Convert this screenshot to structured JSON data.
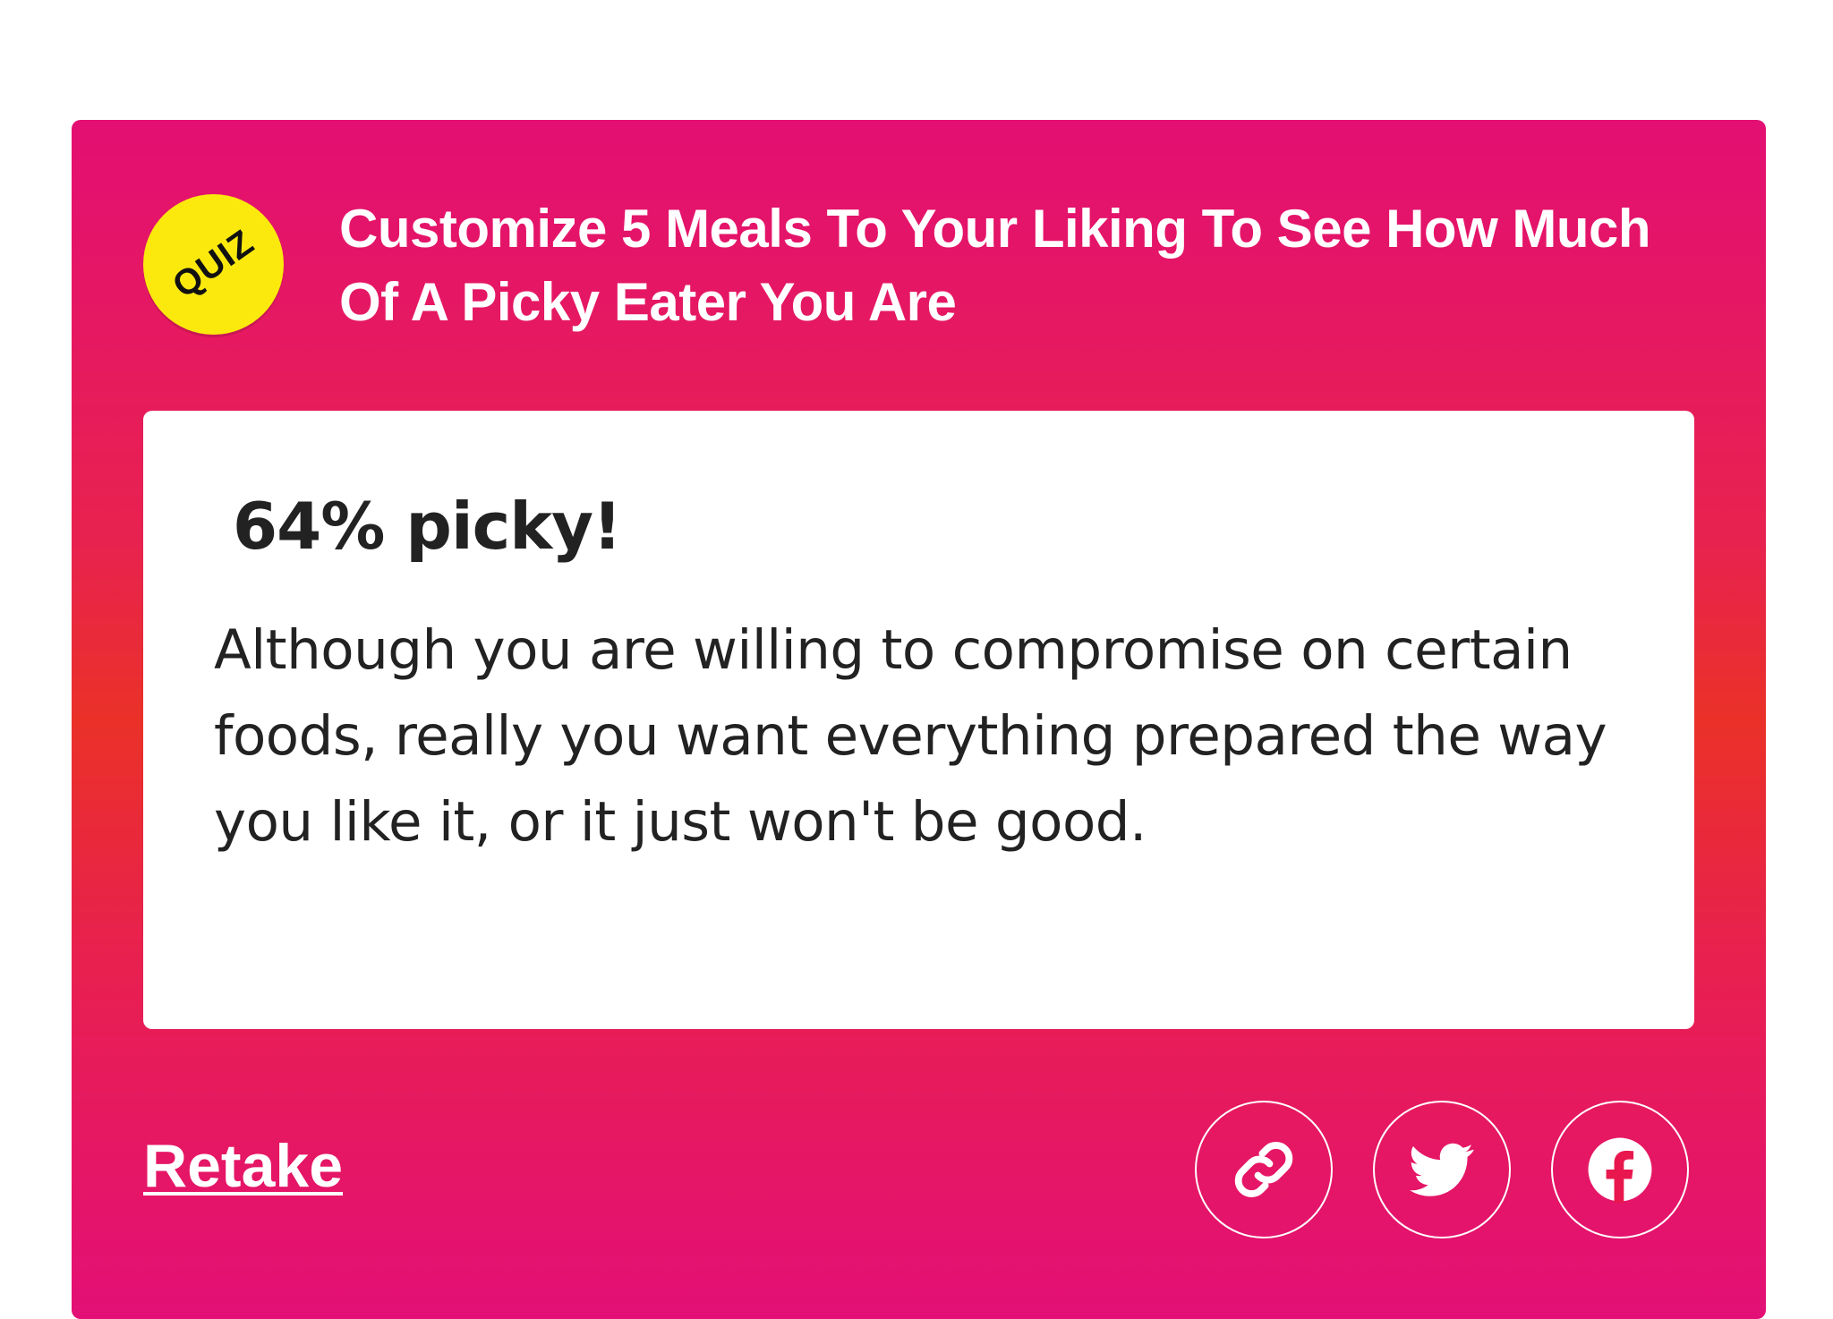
{
  "quiz": {
    "badge_label": "QUIZ",
    "title": "Customize 5 Meals To Your Liking To See How Much Of A Picky Eater You Are"
  },
  "result": {
    "heading": "64% picky!",
    "description": "Although you are willing to compromise on certain foods, really you want everything prepared the way you like it, or it just won't be good."
  },
  "actions": {
    "retake_label": "Retake",
    "share_buttons": [
      {
        "icon": "link-icon"
      },
      {
        "icon": "twitter-icon"
      },
      {
        "icon": "facebook-icon"
      }
    ]
  },
  "colors": {
    "card_gradient_top": "#e30f73",
    "card_gradient_middle": "#ea3128",
    "badge": "#fbe90e",
    "text_dark": "#222222",
    "text_light": "#ffffff"
  }
}
